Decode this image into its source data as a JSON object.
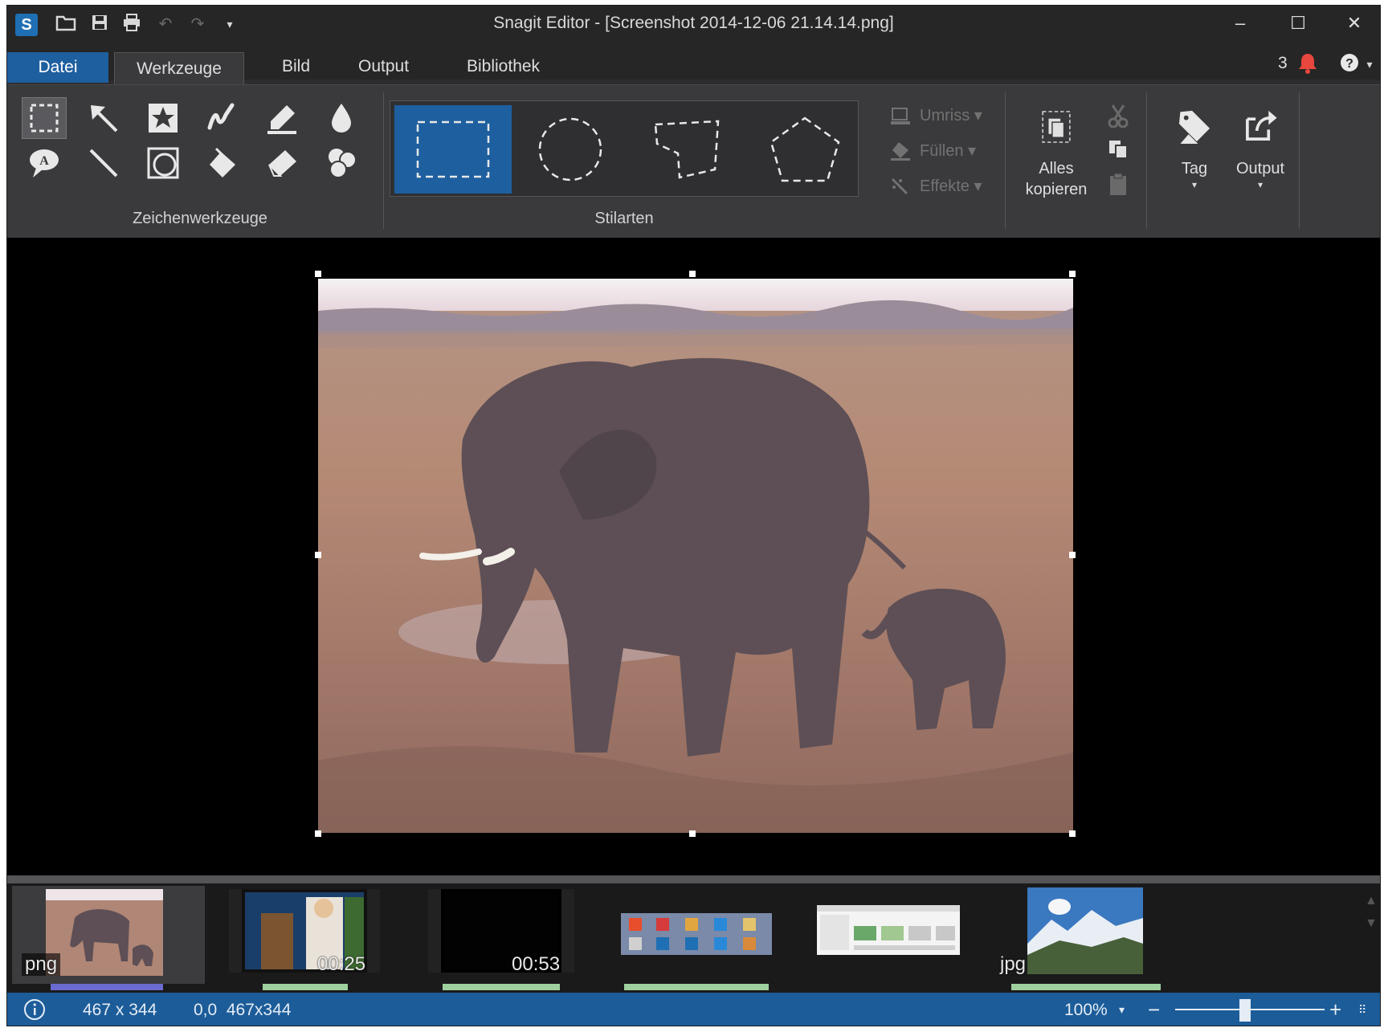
{
  "app": {
    "logo_letter": "S",
    "title": "Snagit Editor - [Screenshot 2014-12-06 21.14.14.png]"
  },
  "window_controls": {
    "minimize": "–",
    "maximize": "☐",
    "close": "✕"
  },
  "quick_access": [
    "open-icon",
    "save-icon",
    "print-icon",
    "undo-icon",
    "redo-icon",
    "customize-icon"
  ],
  "menu": {
    "tabs": [
      {
        "label": "Datei"
      },
      {
        "label": "Werkzeuge",
        "active": true
      },
      {
        "label": "Bild"
      },
      {
        "label": "Output"
      },
      {
        "label": "Bibliothek"
      }
    ],
    "notification_count": "3"
  },
  "ribbon": {
    "drawing_tools_label": "Zeichenwerkzeuge",
    "drawing_tools": [
      "selection-icon",
      "arrow-icon",
      "stamp-icon",
      "pen-icon",
      "highlighter-icon",
      "blur-icon",
      "callout-icon",
      "line-icon",
      "shape-icon",
      "fill-icon",
      "eraser-icon",
      "step-icon"
    ],
    "styles_label": "Stilarten",
    "styles": [
      "rectangle-selection",
      "ellipse-selection",
      "freehand-selection",
      "polygon-selection"
    ],
    "format": {
      "outline": "Umriss",
      "fill": "Füllen",
      "effects": "Effekte"
    },
    "copy_all": {
      "line1": "Alles",
      "line2": "kopieren"
    },
    "tag": "Tag",
    "output": "Output"
  },
  "tray": {
    "items": [
      {
        "label": "png",
        "kind": "image",
        "selected": true
      },
      {
        "label": "00:25",
        "kind": "video"
      },
      {
        "label": "00:53",
        "kind": "video"
      },
      {
        "label": "",
        "kind": "image"
      },
      {
        "label": "",
        "kind": "image"
      },
      {
        "label": "jpg",
        "kind": "image"
      }
    ]
  },
  "status": {
    "image_size": "467 x 344",
    "selection": "0,0  467x344",
    "zoom": "100%",
    "zoom_level": 1.0
  },
  "colors": {
    "accent": "#1e5f9f",
    "ribbon": "#3a3a3d",
    "titlebar": "#262626",
    "canvas": "#000000",
    "notification": "#e8473d"
  }
}
